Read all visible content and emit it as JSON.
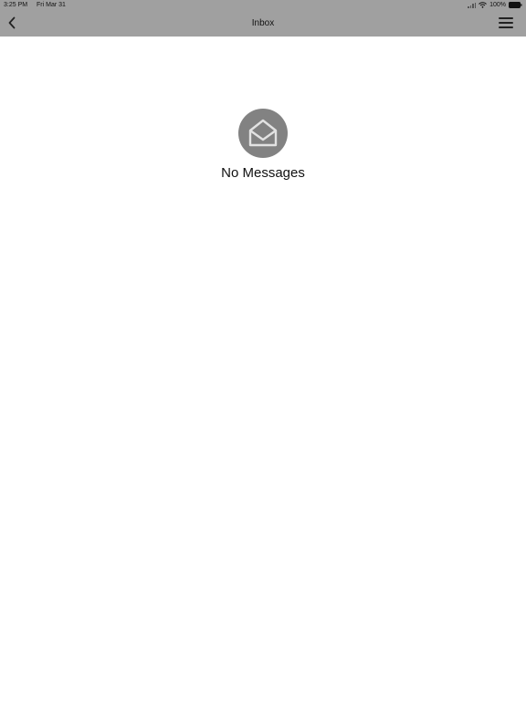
{
  "status_bar": {
    "time": "3:25 PM",
    "date": "Fri Mar 31",
    "battery": "100%",
    "icons": [
      "signal-icon",
      "wifi-icon",
      "battery-icon"
    ]
  },
  "nav": {
    "title": "Inbox",
    "back_icon": "chevron-left-icon",
    "menu_icon": "hamburger-menu-icon"
  },
  "empty_state": {
    "icon": "open-envelope-icon",
    "message": "No Messages"
  },
  "colors": {
    "bar_background": "#a0a0a0",
    "icon_circle": "#828282",
    "background": "#ffffff"
  }
}
